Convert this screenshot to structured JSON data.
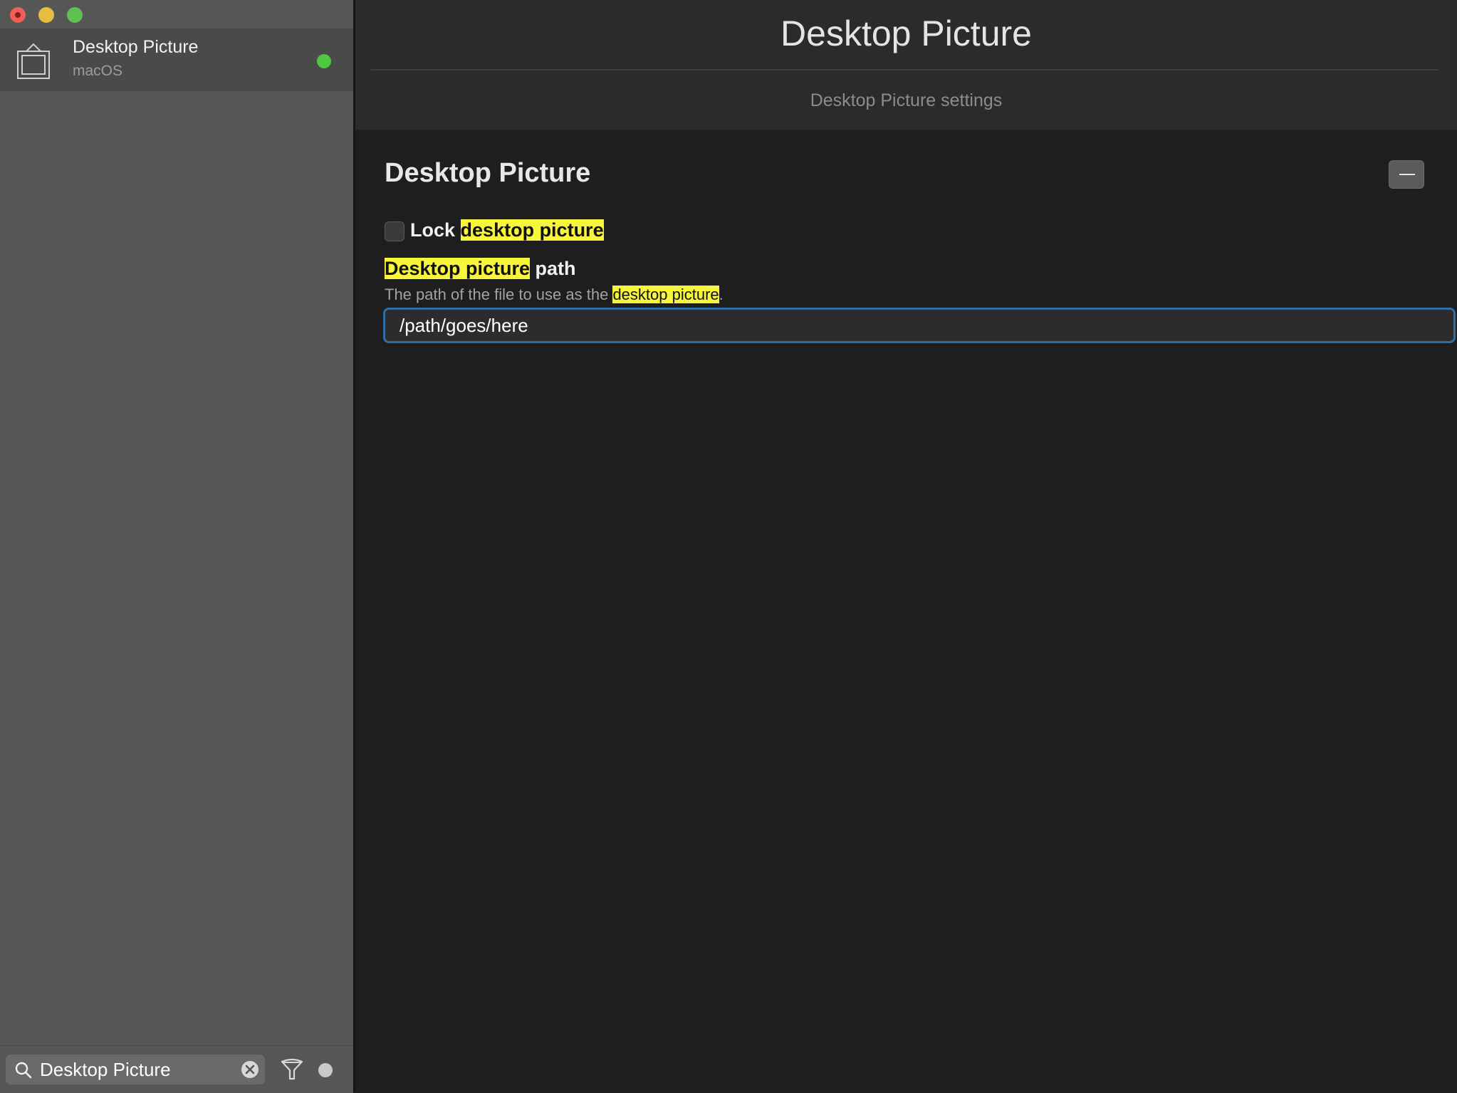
{
  "sidebar": {
    "items": [
      {
        "title": "Desktop Picture",
        "subtitle": "macOS",
        "status_color": "#4cc93f"
      }
    ],
    "search": {
      "value": "Desktop Picture"
    }
  },
  "header": {
    "title": "Desktop Picture",
    "subtitle": "Desktop Picture settings"
  },
  "section": {
    "title": "Desktop Picture",
    "lock": {
      "prefix": "Lock",
      "highlight": "desktop picture",
      "checked": false
    },
    "path": {
      "label_highlight": "Desktop picture",
      "label_rest": " path",
      "description_prefix": "The path of the file to use as the ",
      "description_highlight": "desktop picture",
      "description_suffix": ".",
      "value": "/path/goes/here"
    }
  },
  "colors": {
    "highlight": "#f8f63a",
    "focus_ring": "#2f6ea4"
  }
}
